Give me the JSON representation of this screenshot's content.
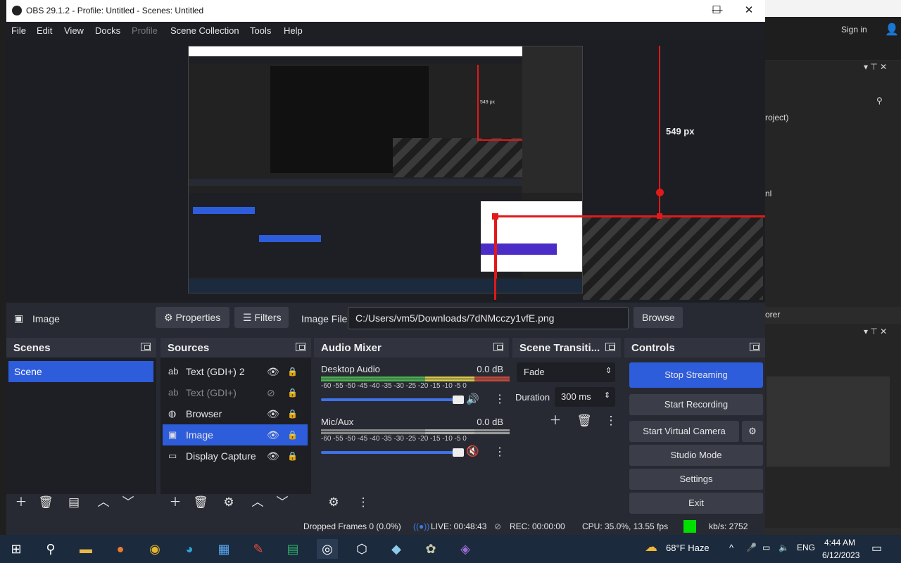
{
  "window": {
    "title": "OBS 29.1.2 - Profile: Untitled - Scenes: Untitled",
    "min": "—",
    "max": "☐",
    "close": "✕"
  },
  "menu": [
    "File",
    "Edit",
    "View",
    "Docks",
    "Profile",
    "Scene Collection",
    "Tools",
    "Help"
  ],
  "preview": {
    "measure_label": "549 px",
    "nested_measure_label": "549 px"
  },
  "source_toolbar": {
    "source_name": "Image",
    "properties": "Properties",
    "filters": "Filters",
    "image_file_label": "Image File",
    "image_file_value": "C:/Users/vm5/Downloads/7dNMcczy1vfE.png",
    "browse": "Browse"
  },
  "scenes": {
    "title": "Scenes",
    "items": [
      "Scene"
    ]
  },
  "sources": {
    "title": "Sources",
    "items": [
      {
        "icon": "ab",
        "label": "Text (GDI+) 2",
        "visible": true
      },
      {
        "icon": "ab",
        "label": "Text (GDI+)",
        "visible": false
      },
      {
        "icon": "◍",
        "label": "Browser",
        "visible": true
      },
      {
        "icon": "▣",
        "label": "Image",
        "visible": true,
        "selected": true
      },
      {
        "icon": "▭",
        "label": "Display Capture",
        "visible": true
      }
    ]
  },
  "audio": {
    "title": "Audio Mixer",
    "channels": [
      {
        "name": "Desktop Audio",
        "db": "0.0 dB",
        "muted": false
      },
      {
        "name": "Mic/Aux",
        "db": "0.0 dB",
        "muted": true
      }
    ],
    "scale": "-60 -55 -50 -45 -40 -35 -30 -25 -20 -15 -10 -5 0"
  },
  "transitions": {
    "title": "Scene Transiti...",
    "type": "Fade",
    "duration_label": "Duration",
    "duration_value": "300 ms"
  },
  "controls": {
    "title": "Controls",
    "stop_streaming": "Stop Streaming",
    "start_recording": "Start Recording",
    "start_virtual_camera": "Start Virtual Camera",
    "studio_mode": "Studio Mode",
    "settings": "Settings",
    "exit": "Exit"
  },
  "status": {
    "dropped": "Dropped Frames 0 (0.0%)",
    "live": "LIVE: 00:48:43",
    "rec": "REC: 00:00:00",
    "cpu": "CPU: 35.0%, 13.55 fps",
    "kbps": "kb/s: 2752"
  },
  "bg_app": {
    "sign_in": "Sign in",
    "project": "roject)",
    "item": "nl",
    "explorer": "orer"
  },
  "taskbar": {
    "weather": "68°F  Haze",
    "lang": "ENG",
    "time": "4:44 AM",
    "date": "6/12/2023"
  },
  "colors": {
    "accent": "#2e5ddb",
    "live_green": "#00e000",
    "guide_red": "#e11919"
  }
}
